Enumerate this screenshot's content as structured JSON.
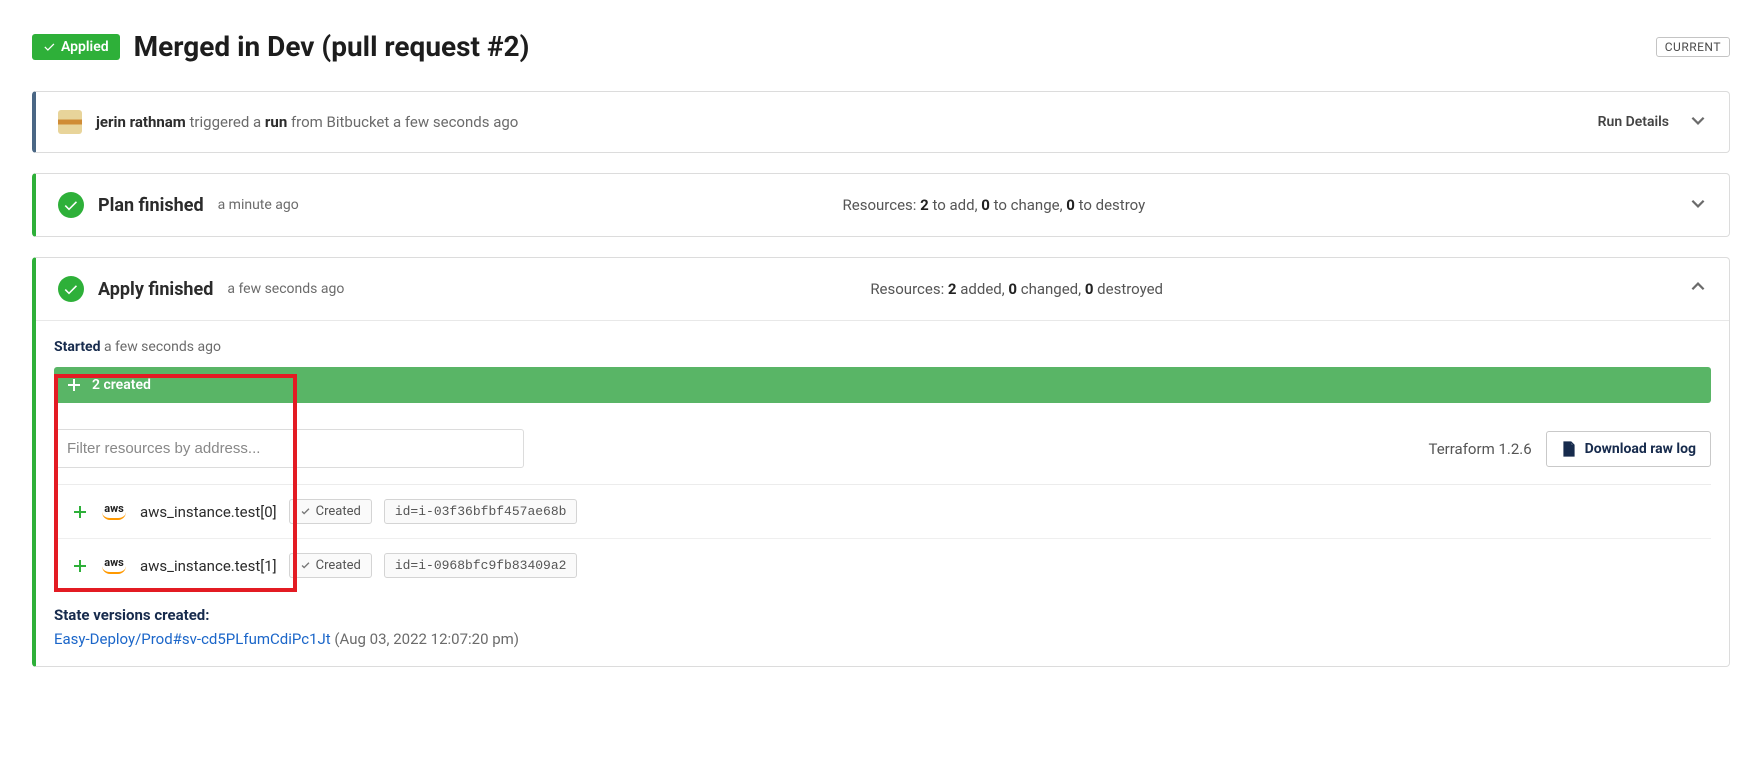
{
  "header": {
    "applied_badge": "Applied",
    "title": "Merged in Dev (pull request #2)",
    "current_badge": "CURRENT"
  },
  "run_card": {
    "triggered_prefix": "jerin rathnam",
    "triggered_mid": " triggered a ",
    "triggered_run": "run",
    "triggered_suffix": " from Bitbucket a few seconds ago",
    "details_label": "Run Details"
  },
  "plan": {
    "title": "Plan finished",
    "time": "a minute ago",
    "resources_prefix": "Resources: ",
    "add": "2",
    "add_suffix": " to add, ",
    "change": "0",
    "change_suffix": " to change, ",
    "destroy": "0",
    "destroy_suffix": " to destroy"
  },
  "apply": {
    "title": "Apply finished",
    "time": "a few seconds ago",
    "resources_prefix": "Resources: ",
    "add": "2",
    "add_suffix": " added, ",
    "change": "0",
    "change_suffix": " changed, ",
    "destroy": "0",
    "destroy_suffix": " destroyed",
    "started_label": "Started",
    "started_time": " a few seconds ago",
    "created_banner": "2 created",
    "filter_placeholder": "Filter resources by address...",
    "tf_version": "Terraform 1.2.6",
    "download_label": "Download raw log",
    "resources": [
      {
        "name": "aws_instance.test[0]",
        "status": "Created",
        "id": "id=i-03f36bfbf457ae68b"
      },
      {
        "name": "aws_instance.test[1]",
        "status": "Created",
        "id": "id=i-0968bfc9fb83409a2"
      }
    ],
    "state_title": "State versions created:",
    "state_link": "Easy-Deploy/Prod#sv-cd5PLfumCdiPc1Jt",
    "state_date": " (Aug 03, 2022 12:07:20 pm)"
  }
}
